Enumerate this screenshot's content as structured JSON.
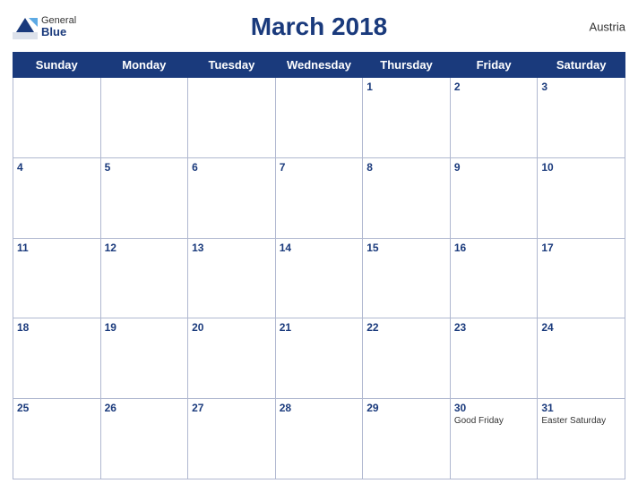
{
  "header": {
    "title": "March 2018",
    "country": "Austria"
  },
  "logo": {
    "general": "General",
    "blue": "Blue"
  },
  "days_of_week": [
    "Sunday",
    "Monday",
    "Tuesday",
    "Wednesday",
    "Thursday",
    "Friday",
    "Saturday"
  ],
  "weeks": [
    [
      {
        "num": "",
        "event": ""
      },
      {
        "num": "",
        "event": ""
      },
      {
        "num": "",
        "event": ""
      },
      {
        "num": "",
        "event": ""
      },
      {
        "num": "1",
        "event": ""
      },
      {
        "num": "2",
        "event": ""
      },
      {
        "num": "3",
        "event": ""
      }
    ],
    [
      {
        "num": "4",
        "event": ""
      },
      {
        "num": "5",
        "event": ""
      },
      {
        "num": "6",
        "event": ""
      },
      {
        "num": "7",
        "event": ""
      },
      {
        "num": "8",
        "event": ""
      },
      {
        "num": "9",
        "event": ""
      },
      {
        "num": "10",
        "event": ""
      }
    ],
    [
      {
        "num": "11",
        "event": ""
      },
      {
        "num": "12",
        "event": ""
      },
      {
        "num": "13",
        "event": ""
      },
      {
        "num": "14",
        "event": ""
      },
      {
        "num": "15",
        "event": ""
      },
      {
        "num": "16",
        "event": ""
      },
      {
        "num": "17",
        "event": ""
      }
    ],
    [
      {
        "num": "18",
        "event": ""
      },
      {
        "num": "19",
        "event": ""
      },
      {
        "num": "20",
        "event": ""
      },
      {
        "num": "21",
        "event": ""
      },
      {
        "num": "22",
        "event": ""
      },
      {
        "num": "23",
        "event": ""
      },
      {
        "num": "24",
        "event": ""
      }
    ],
    [
      {
        "num": "25",
        "event": ""
      },
      {
        "num": "26",
        "event": ""
      },
      {
        "num": "27",
        "event": ""
      },
      {
        "num": "28",
        "event": ""
      },
      {
        "num": "29",
        "event": ""
      },
      {
        "num": "30",
        "event": "Good Friday"
      },
      {
        "num": "31",
        "event": "Easter Saturday"
      }
    ]
  ]
}
